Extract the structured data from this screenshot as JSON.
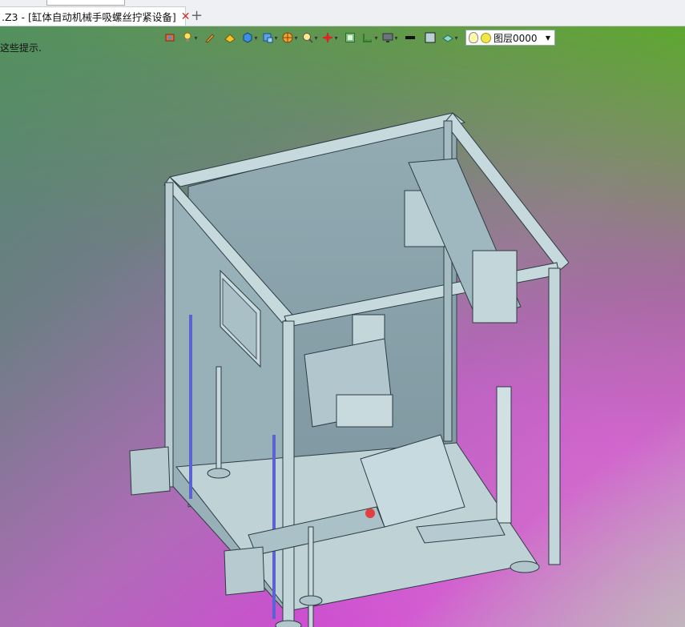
{
  "tab": {
    "title": ".Z3 - [缸体自动机械手吸螺丝拧紧设备]",
    "close": "✕",
    "add": "+"
  },
  "viewport": {
    "hint": "这些提示."
  },
  "toolbar": {
    "layer_label": "图层0000",
    "icons": [
      "view-icon",
      "light-icon",
      "pen-icon",
      "paint-icon",
      "box-icon",
      "cube-render-icon",
      "sphere-icon",
      "zoom-icon",
      "axis-icon",
      "frame-icon",
      "ruler-icon",
      "display-icon",
      "line-style-icon",
      "color-box-icon",
      "surface-icon",
      "bulb-icon"
    ]
  },
  "colors": {
    "accent_green": "#5aa52a",
    "accent_magenta": "#d745d9",
    "model": "#b9d2d6"
  }
}
